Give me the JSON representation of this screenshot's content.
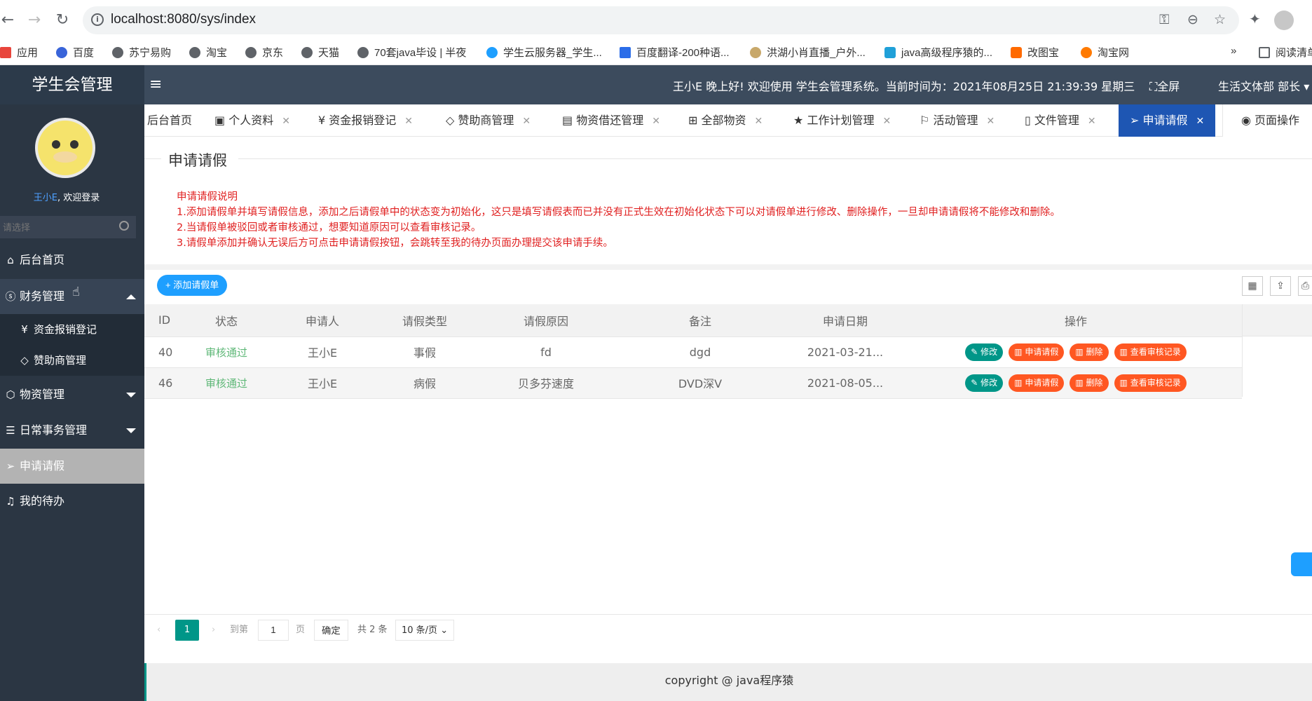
{
  "browser": {
    "url": "localhost:8080/sys/index",
    "bookmarks": [
      "应用",
      "百度",
      "苏宁易购",
      "淘宝",
      "京东",
      "天猫",
      "70套java毕设 | 半夜",
      "学生云服务器_学生...",
      "百度翻译-200种语...",
      "洪湖小肖直播_户外...",
      "java高级程序猿的...",
      "改图宝",
      "淘宝网",
      "阅读清单"
    ],
    "more": "»"
  },
  "app": {
    "title": "学生会管理",
    "greeting": "王小E 晚上好!  欢迎使用 学生会管理系统。当前时间为：2021年08月25日 21:39:39   星期三",
    "fullscreen": "全屏",
    "user_dept": "生活文体部 部长"
  },
  "sidebar": {
    "user_name": "王小E",
    "welcome_suffix": ", 欢迎登录",
    "search_placeholder": "请选择",
    "items": [
      {
        "label": "后台首页",
        "icon": "home-icon"
      },
      {
        "label": "财务管理",
        "icon": "yuan-circle-icon"
      },
      {
        "label": "资金报销登记",
        "icon": "yuan-icon"
      },
      {
        "label": "赞助商管理",
        "icon": "diamond-icon"
      },
      {
        "label": "物资管理",
        "icon": "cube-icon"
      },
      {
        "label": "日常事务管理",
        "icon": "sliders-icon"
      },
      {
        "label": "申请请假",
        "icon": "send-icon"
      },
      {
        "label": "我的待办",
        "icon": "bell-icon"
      }
    ]
  },
  "tabs": [
    {
      "label": "后台首页"
    },
    {
      "label": "个人资料"
    },
    {
      "label": "资金报销登记"
    },
    {
      "label": "赞助商管理"
    },
    {
      "label": "物资借还管理"
    },
    {
      "label": "全部物资"
    },
    {
      "label": "工作计划管理"
    },
    {
      "label": "活动管理"
    },
    {
      "label": "文件管理"
    },
    {
      "label": "申请请假"
    }
  ],
  "page_ops": "页面操作",
  "page": {
    "title": "申请请假",
    "notice_title": "申请请假说明",
    "notice_lines": [
      "1.添加请假单并填写请假信息，添加之后请假单中的状态变为初始化，这只是填写请假表而已并没有正式生效在初始化状态下可以对请假单进行修改、删除操作，一旦却申请请假将不能修改和删除。",
      "2.当请假单被驳回或者审核通过，想要知道原因可以查看审核记录。",
      "3.请假单添加并确认无误后方可点击申请请假按钮，会跳转至我的待办页面办理提交该申请手续。"
    ],
    "add_button": "添加请假单"
  },
  "table": {
    "headers": [
      "ID",
      "状态",
      "申请人",
      "请假类型",
      "请假原因",
      "备注",
      "申请日期",
      "操作"
    ],
    "rows": [
      {
        "id": "40",
        "status": "审核通过",
        "applicant": "王小E",
        "type": "事假",
        "reason": "fd",
        "remark": "dgd",
        "date": "2021-03-21..."
      },
      {
        "id": "46",
        "status": "审核通过",
        "applicant": "王小E",
        "type": "病假",
        "reason": "贝多芬速度",
        "remark": "DVD深V",
        "date": "2021-08-05..."
      }
    ],
    "actions": {
      "edit": "修改",
      "apply": "申请请假",
      "delete": "删除",
      "view": "查看审核记录"
    }
  },
  "pager": {
    "current": "1",
    "goto_label": "到第",
    "goto_value": "1",
    "page_unit": "页",
    "confirm": "确定",
    "total": "共 2 条",
    "page_size": "10 条/页"
  },
  "footer": "copyright @  java程序猿",
  "colors": {
    "header": "#3c4b5d",
    "sidebar": "#2b3643",
    "active_tab": "#1e56b3",
    "teal": "#009688",
    "orange": "#ff5722",
    "notice": "#e02020",
    "status_ok": "#5fb878"
  }
}
